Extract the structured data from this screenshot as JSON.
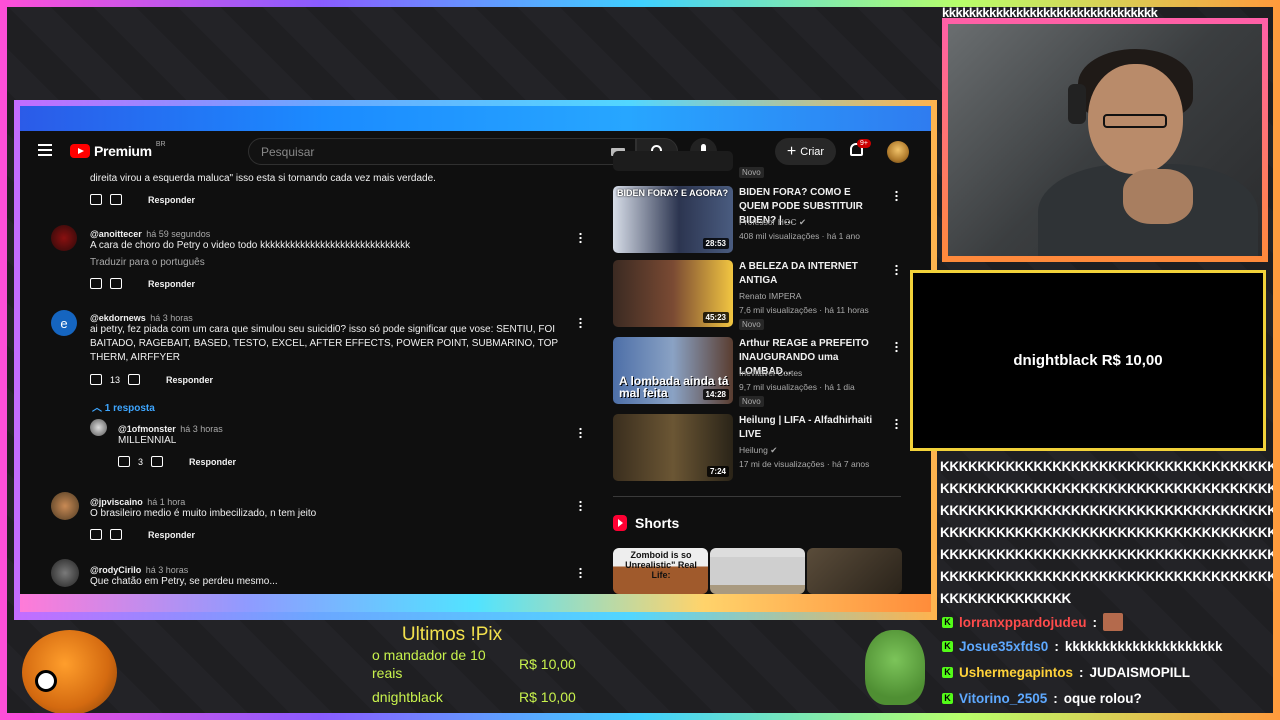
{
  "youtube": {
    "logo_text": "Premium",
    "region": "BR",
    "search_placeholder": "Pesquisar",
    "create_label": "Criar",
    "notif_badge": "9+",
    "comments": [
      {
        "text": "direita virou a esquerda maluca\" isso esta si tornando cada vez mais verdade.",
        "reply": "Responder"
      },
      {
        "author": "@anoittecer",
        "time": "há 59 segundos",
        "text": "A cara de choro do Petry o video todo kkkkkkkkkkkkkkkkkkkkkkkkkkkkkk",
        "translate": "Traduzir para o português",
        "reply": "Responder"
      },
      {
        "author": "@ekdornews",
        "time": "há 3 horas",
        "text": "ai petry, fez piada com um cara que simulou seu suicidi0? isso só pode significar que vose: SENTIU, FOI BAITADO, RAGEBAIT, BASED, TESTO, EXCEL, AFTER EFFECTS, POWER POINT, SUBMARINO, TOP THERM, AIRFFYER",
        "likes": "13",
        "reply": "Responder",
        "replies_toggle": "1 resposta"
      },
      {
        "author": "@1ofmonster",
        "time": "há 3 horas",
        "text": "MILLENNIAL",
        "likes": "3",
        "reply": "Responder"
      },
      {
        "author": "@jpviscaino",
        "time": "há 1 hora",
        "text": "O brasileiro medio é muito imbecilizado, n tem jeito",
        "reply": "Responder"
      },
      {
        "author": "@rodyCirilo",
        "time": "há 3 horas",
        "text": "Que chatão em Petry, se perdeu mesmo..."
      }
    ],
    "videos": [
      {
        "badge": "Novo"
      },
      {
        "title": "BIDEN FORA? COMO E QUEM PODE SUBSTITUIR BIDEN? | ...",
        "channel": "Professor HOC",
        "stats": "408 mil visualizações · há 1 ano",
        "duration": "28:53",
        "thumb_text": "BIDEN FORA? E AGORA?"
      },
      {
        "title": "A BELEZA DA INTERNET ANTIGA",
        "channel": "Renato IMPERA",
        "stats": "7,6 mil visualizações · há 11 horas",
        "badge": "Novo",
        "duration": "45:23"
      },
      {
        "title": "Arthur REAGE a PREFEITO INAUGURANDO uma LOMBAD...",
        "channel": "Inevitável Cortes",
        "stats": "9,7 mil visualizações · há 1 dia",
        "badge": "Novo",
        "duration": "14:28",
        "thumb_text": "A lombada ainda tá mal feita"
      },
      {
        "title": "Heilung | LIFA - Alfadhirhaiti LIVE",
        "channel": "Heilung",
        "stats": "17 mi de visualizações · há 7 anos",
        "duration": "7:24"
      }
    ],
    "shorts_label": "Shorts",
    "shorts": [
      {
        "text": "Zomboid is so Unrealistic\" Real Life:"
      },
      {
        "text": ""
      },
      {
        "text": ""
      }
    ]
  },
  "stream": {
    "chat_top": "kkkkkkkkkkkkkkkkkkkkkkkkkkkkkkkk",
    "donation_text": "dnightblack R$ 10,00",
    "k_lines": [
      "KKKKKKKKKKKKKKKKKKKKKKKKKKKKKKKKKKKKKKKK",
      "KKKKKKKKKKKKKKKKKKKKKKKKKKKKKKKKKKKKKKKK",
      "KKKKKKKKKKKKKKKKKKKKKKKKKKKKKKKKKKKKKKKK",
      "KKKKKKKKKKKKKKKKKKKKKKKKKKKKKKKKKKKKKKKK",
      "KKKKKKKKKKKKKKKKKKKKKKKKKKKKKKKKKKKKKKKK",
      "KKKKKKKKKKKKKKKKKKKKKKKKKKKKKKKKKKKKKKKK",
      "KKKKKKKKKKKKKK"
    ],
    "chat": [
      {
        "user": "lorranxppardojudeu",
        "sep": ":",
        "msg": ""
      },
      {
        "user": "Josue35xfds0",
        "sep": ":",
        "msg": "kkkkkkkkkkkkkkkkkkkkk"
      },
      {
        "user": "Ushermegapintos",
        "sep": ":",
        "msg": "JUDAISMOPILL"
      },
      {
        "user": "Vitorino_2505",
        "sep": ":",
        "msg": "oque rolou?"
      }
    ],
    "pix_title": "Ultimos !Pix",
    "pix": [
      {
        "name": "o mandador de 10",
        "name2": "reais",
        "amount": "R$ 10,00"
      },
      {
        "name": "dnightblack",
        "amount": "R$ 10,00"
      }
    ]
  }
}
